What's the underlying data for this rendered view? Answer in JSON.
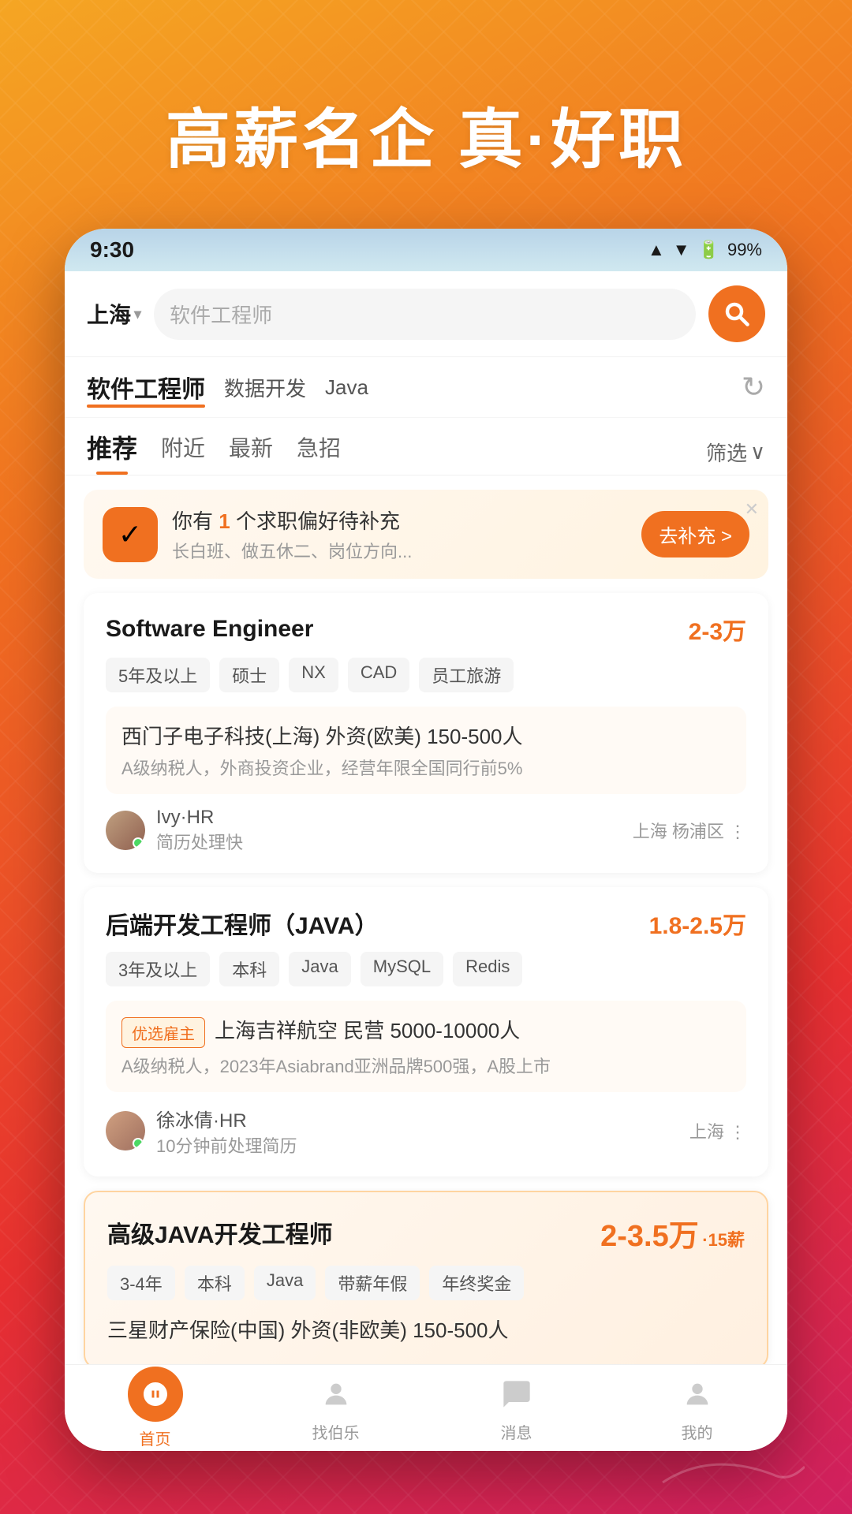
{
  "hero": {
    "title": "高薪名企 真·好职"
  },
  "statusBar": {
    "time": "9:30",
    "battery": "99%"
  },
  "search": {
    "city": "上海",
    "placeholder": "软件工程师",
    "button_icon": "search"
  },
  "jobCategories": {
    "active": "软件工程师",
    "items": [
      "数据开发",
      "Java"
    ]
  },
  "tabs": {
    "items": [
      "推荐",
      "附近",
      "最新",
      "急招"
    ],
    "active": 0,
    "filter": "筛选"
  },
  "notification": {
    "title_prefix": "你有",
    "count": "1",
    "title_suffix": "个求职偏好待补充",
    "sub": "长白班、做五休二、岗位方向...",
    "btn": "去补充 >"
  },
  "jobs": [
    {
      "title": "Software Engineer",
      "salary": "2-3万",
      "tags": [
        "5年及以上",
        "硕士",
        "NX",
        "CAD",
        "员工旅游"
      ],
      "company": {
        "name": "西门子电子科技(上海)  外资(欧美)  150-500人",
        "desc": "A级纳税人，外商投资企业，经营年限全国同行前5%",
        "preferred": false
      },
      "hr": {
        "name": "Ivy·HR",
        "status": "简历处理快",
        "location": "上海 杨浦区"
      }
    },
    {
      "title": "后端开发工程师（JAVA）",
      "salary": "1.8-2.5万",
      "tags": [
        "3年及以上",
        "本科",
        "Java",
        "MySQL",
        "Redis"
      ],
      "company": {
        "name": "上海吉祥航空  民营  5000-10000人",
        "desc": "A级纳税人，2023年Asiabrand亚洲品牌500强，A股上市",
        "preferred": true
      },
      "hr": {
        "name": "徐冰倩·HR",
        "status": "10分钟前处理简历",
        "location": "上海"
      }
    },
    {
      "title": "高级JAVA开发工程师",
      "salary": "2-3.5万·15薪",
      "salary_main": "2-3.5万",
      "salary_sub": "·15薪",
      "tags": [
        "3-4年",
        "本科",
        "Java",
        "带薪年假",
        "年终奖金"
      ],
      "company": {
        "name": "三星财产保险(中国)  外资(非欧美)  150-500人",
        "desc": "",
        "preferred": false
      },
      "hr": {
        "name": "",
        "status": "",
        "location": ""
      },
      "highlight": true
    }
  ],
  "bottomNav": {
    "items": [
      {
        "label": "首页",
        "icon": "home",
        "active": true
      },
      {
        "label": "找伯乐",
        "icon": "find",
        "active": false
      },
      {
        "label": "消息",
        "icon": "message",
        "active": false
      },
      {
        "label": "我的",
        "icon": "profile",
        "active": false
      }
    ]
  }
}
